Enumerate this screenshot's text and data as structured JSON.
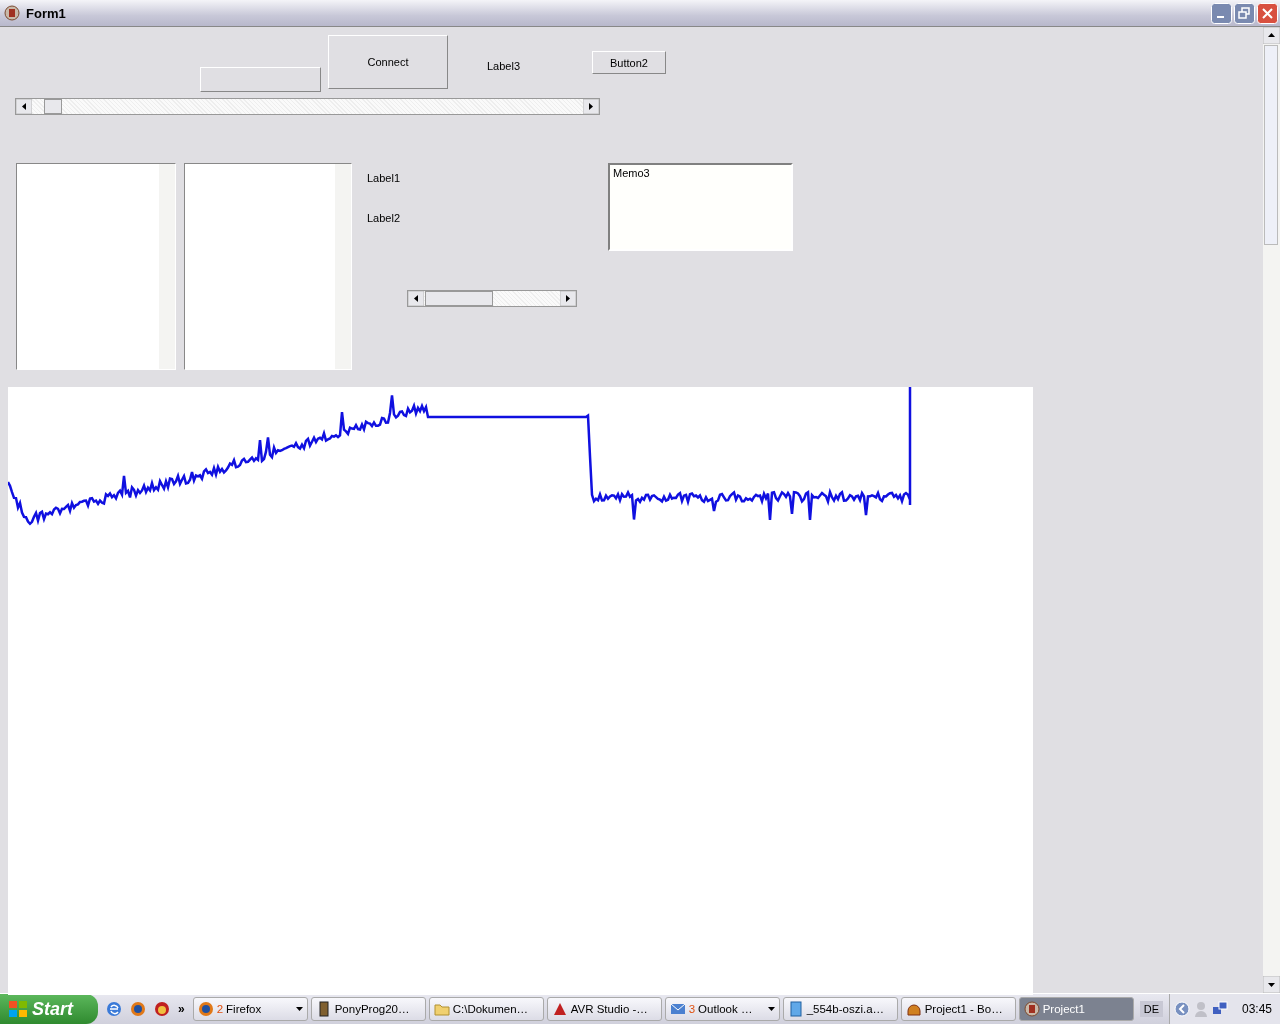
{
  "window": {
    "title": "Form1"
  },
  "form": {
    "connect_button": "Connect",
    "button2": "Button2",
    "label3": "Label3",
    "label1": "Label1",
    "label2": "Label2",
    "memo": "Memo3"
  },
  "taskbar": {
    "start": "Start",
    "more": "»",
    "buttons": [
      {
        "count": "2",
        "label": "Firefox",
        "grouped": true,
        "selected": false
      },
      {
        "label": "PonyProg20…",
        "grouped": false,
        "selected": false
      },
      {
        "label": "C:\\Dokumen…",
        "grouped": false,
        "selected": false
      },
      {
        "label": "AVR Studio -…",
        "grouped": false,
        "selected": false
      },
      {
        "count": "3",
        "label": "Outlook …",
        "grouped": true,
        "selected": false
      },
      {
        "label": "_554b-oszi.a…",
        "grouped": false,
        "selected": false
      },
      {
        "label": "Project1 - Bo…",
        "grouped": false,
        "selected": false
      },
      {
        "label": "Project1",
        "grouped": false,
        "selected": true
      }
    ],
    "language": "DE",
    "clock": "03:45"
  }
}
